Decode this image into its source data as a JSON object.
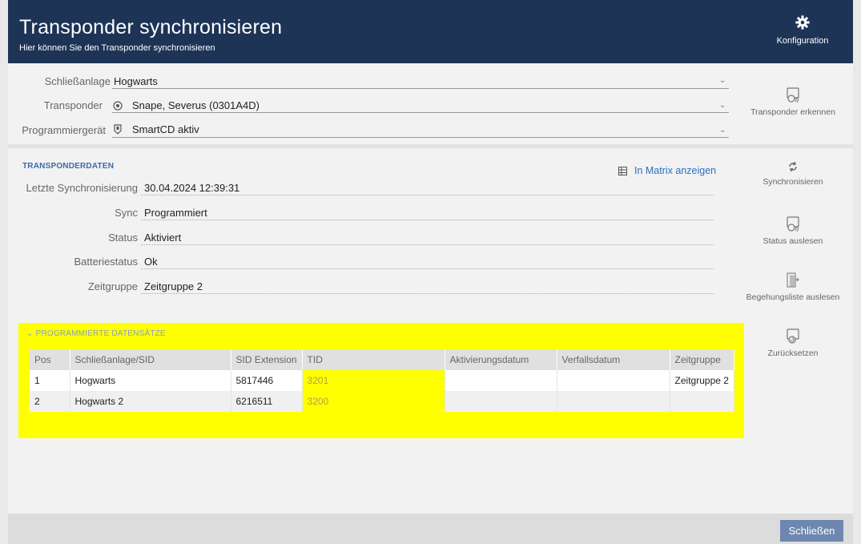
{
  "header": {
    "title": "Transponder synchronisieren",
    "subtitle": "Hier können Sie den Transponder synchronisieren",
    "config_label": "Konfiguration"
  },
  "form": {
    "locking_system_label": "Schließanlage",
    "locking_system_value": "Hogwarts",
    "transponder_label": "Transponder",
    "transponder_value": "Snape, Severus (0301A4D)",
    "programmer_label": "Programmiergerät",
    "programmer_value": "SmartCD aktiv"
  },
  "detect_button": "Transponder erkennen",
  "transponder_data": {
    "section_title": "TRANSPONDERDATEN",
    "matrix_link": "In Matrix anzeigen",
    "rows": [
      {
        "label": "Letzte Synchronisierung",
        "value": "30.04.2024 12:39:31"
      },
      {
        "label": "Sync",
        "value": "Programmiert"
      },
      {
        "label": "Status",
        "value": "Aktiviert"
      },
      {
        "label": "Batteriestatus",
        "value": "Ok"
      },
      {
        "label": "Zeitgruppe",
        "value": "Zeitgruppe 2"
      }
    ]
  },
  "side_actions": {
    "sync": "Synchronisieren",
    "read_status": "Status auslesen",
    "read_access_list": "Begehungsliste auslesen",
    "reset": "Zurücksetzen"
  },
  "programmed_records": {
    "section_title": "PROGRAMMIERTE DATENSÄTZE",
    "columns": [
      "Pos",
      "Schließanlage/SID",
      "SID Extension",
      "TID",
      "Aktivierungsdatum",
      "Verfallsdatum",
      "Zeitgruppe"
    ],
    "rows": [
      [
        "1",
        "Hogwarts",
        "5817446",
        "3201",
        "",
        "",
        "Zeitgruppe 2"
      ],
      [
        "2",
        "Hogwarts 2",
        "6216511",
        "3200",
        "",
        "",
        ""
      ]
    ]
  },
  "footer": {
    "close_label": "Schließen"
  },
  "colors": {
    "header_bg": "#1e3456",
    "highlight": "#ffff00",
    "link": "#2a6fc5",
    "close_button": "#6d87b0"
  }
}
